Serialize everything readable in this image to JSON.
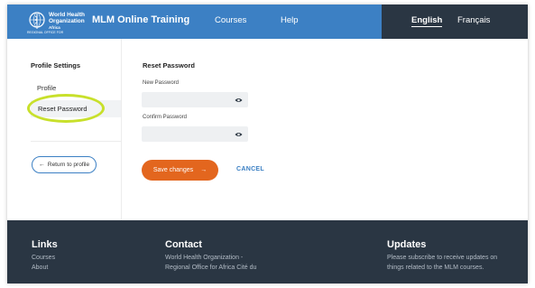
{
  "header": {
    "logo": {
      "org_line1": "World Health",
      "org_line2": "Organization",
      "region": "Africa",
      "subtitle": "REGIONAL OFFICE FOR"
    },
    "app_title": "MLM Online Training",
    "nav": {
      "courses": "Courses",
      "help": "Help"
    },
    "languages": {
      "english": "English",
      "french": "Français",
      "active": "English"
    }
  },
  "sidebar": {
    "heading": "Profile Settings",
    "items": [
      {
        "label": "Profile"
      },
      {
        "label": "Reset Password",
        "selected": true
      }
    ],
    "return_button": {
      "icon": "arrow-left-icon",
      "label": "Return to profile"
    }
  },
  "main": {
    "title": "Reset Password",
    "new_password": {
      "label": "New Password",
      "value": "",
      "icon": "eye-icon"
    },
    "confirm_password": {
      "label": "Confirm Password",
      "value": "",
      "icon": "eye-icon"
    },
    "save_button": {
      "label": "Save changes",
      "icon": "arrow-right-icon"
    },
    "cancel_button": {
      "label": "CANCEL"
    }
  },
  "footer": {
    "links": {
      "heading": "Links",
      "items": [
        "Courses",
        "About"
      ]
    },
    "contact": {
      "heading": "Contact",
      "line1": "World Health Organization -",
      "line2": "Regional Office for Africa Cité du"
    },
    "updates": {
      "heading": "Updates",
      "line1": "Please subscribe to receive updates on",
      "line2": "things related to the MLM courses."
    }
  },
  "colors": {
    "header_blue": "#3c80c4",
    "header_dark": "#2a3643",
    "accent_orange": "#e3661e",
    "link_blue": "#3c80c4",
    "highlight_ring": "#c8e02b"
  }
}
